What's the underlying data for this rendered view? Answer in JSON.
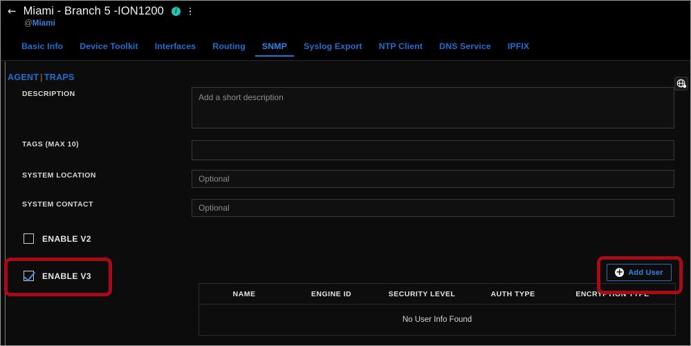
{
  "header": {
    "back_icon": "arrow-left-icon",
    "title": "Miami - Branch 5 -ION1200",
    "info_icon_label": "i",
    "handle_at": "@",
    "handle": "Miami",
    "menu_icon": "kebab-menu-icon"
  },
  "tabs": [
    {
      "label": "Basic Info",
      "active": false
    },
    {
      "label": "Device Toolkit",
      "active": false
    },
    {
      "label": "Interfaces",
      "active": false
    },
    {
      "label": "Routing",
      "active": false
    },
    {
      "label": "SNMP",
      "active": true
    },
    {
      "label": "Syslog Export",
      "active": false
    },
    {
      "label": "NTP Client",
      "active": false
    },
    {
      "label": "DNS Service",
      "active": false
    },
    {
      "label": "IPFIX",
      "active": false
    }
  ],
  "subnav": {
    "agent": "AGENT",
    "separator": "|",
    "traps": "TRAPS"
  },
  "form": {
    "description": {
      "label": "DESCRIPTION",
      "placeholder": "Add a short description",
      "value": ""
    },
    "tags": {
      "label": "TAGS (MAX 10)",
      "placeholder": "",
      "value": ""
    },
    "system_location": {
      "label": "SYSTEM LOCATION",
      "placeholder": "Optional",
      "value": ""
    },
    "system_contact": {
      "label": "SYSTEM CONTACT",
      "placeholder": "Optional",
      "value": ""
    }
  },
  "checkboxes": {
    "enable_v2": {
      "label": "ENABLE V2",
      "checked": false
    },
    "enable_v3": {
      "label": "ENABLE V3",
      "checked": true
    }
  },
  "add_user_button": {
    "label": "Add User",
    "icon": "plus-circle-icon"
  },
  "user_table": {
    "columns": [
      "NAME",
      "ENGINE ID",
      "SECURITY LEVEL",
      "AUTH TYPE",
      "ENCRYPTION TYPE"
    ],
    "rows": [],
    "empty_message": "No User Info Found"
  },
  "help_fab": {
    "icon": "help-globe-icon"
  },
  "colors": {
    "accent_blue": "#2f86e8",
    "link_blue": "#1f6fd0",
    "annotation_red": "#a80a16",
    "info_teal": "#1ec7b6",
    "page_bg": "#0c0c0c",
    "header_bg": "#000000"
  }
}
